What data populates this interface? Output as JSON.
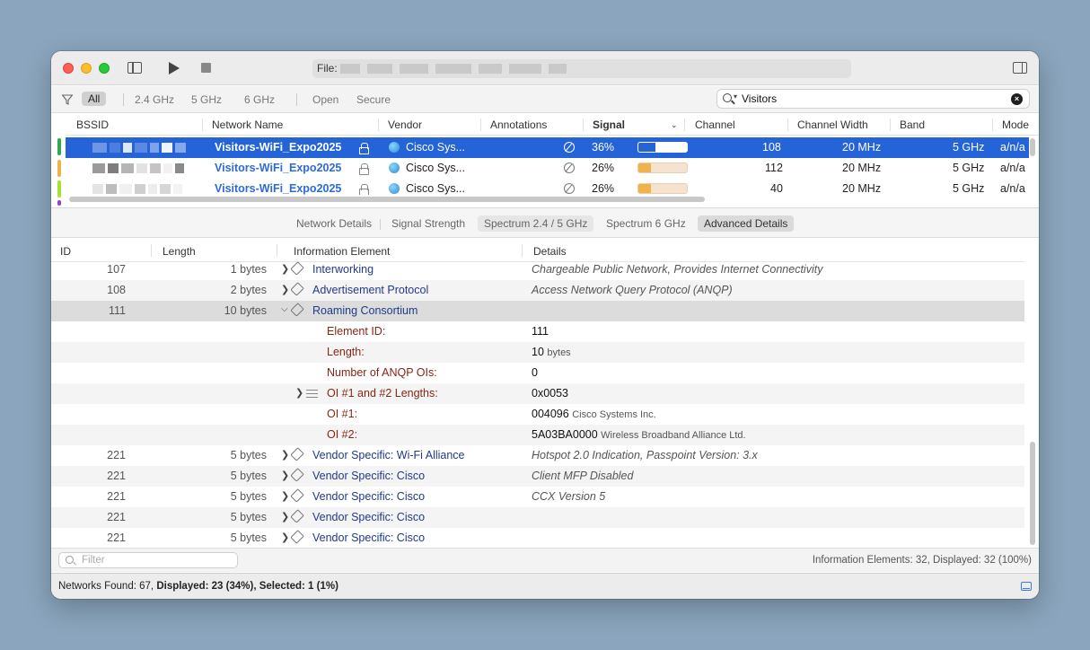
{
  "toolbar": {
    "file_label": "File:"
  },
  "filters": {
    "all": "All",
    "bands": [
      "2.4 GHz",
      "5 GHz",
      "6 GHz"
    ],
    "security": [
      "Open",
      "Secure"
    ],
    "search_value": "Visitors"
  },
  "networks": {
    "columns": [
      "BSSID",
      "Network Name",
      "Vendor",
      "Annotations",
      "Signal",
      "Channel",
      "Channel Width",
      "Band",
      "Mode"
    ],
    "rows": [
      {
        "name": "Visitors-WiFi_Expo2025",
        "vendor": "Cisco Sys...",
        "signal": "36%",
        "signal_level": 0.36,
        "channel": "108",
        "width": "20 MHz",
        "band": "5 GHz",
        "mode": "a/n/a",
        "tag_color": "#2fa84f",
        "selected": true
      },
      {
        "name": "Visitors-WiFi_Expo2025",
        "vendor": "Cisco Sys...",
        "signal": "26%",
        "signal_level": 0.26,
        "channel": "112",
        "width": "20 MHz",
        "band": "5 GHz",
        "mode": "a/n/a",
        "tag_color": "#f0b24a",
        "selected": false
      },
      {
        "name": "Visitors-WiFi_Expo2025",
        "vendor": "Cisco Sys...",
        "signal": "26%",
        "signal_level": 0.26,
        "channel": "40",
        "width": "20 MHz",
        "band": "5 GHz",
        "mode": "a/n/a",
        "tag_color": "#a6e22e",
        "selected": false
      }
    ]
  },
  "tabs": [
    "Network Details",
    "Signal Strength",
    "Spectrum 2.4 / 5 GHz",
    "Spectrum 6 GHz",
    "Advanced Details"
  ],
  "details": {
    "columns": [
      "ID",
      "Length",
      "Information Element",
      "Details"
    ],
    "rows": [
      {
        "id": "107",
        "length": "1 bytes",
        "name": "Interworking",
        "details": "Chargeable Public Network, Provides Internet Connectivity"
      },
      {
        "id": "108",
        "length": "2 bytes",
        "name": "Advertisement Protocol",
        "details": "Access Network Query Protocol (ANQP)"
      },
      {
        "id": "111",
        "length": "10 bytes",
        "name": "Roaming Consortium",
        "details": ""
      }
    ],
    "sub_rows": [
      {
        "label": "Element ID:",
        "value": "111",
        "note": ""
      },
      {
        "label": "Length:",
        "value": "10",
        "note": "bytes"
      },
      {
        "label": "Number of ANQP OIs:",
        "value": "0",
        "note": ""
      },
      {
        "label": "OI #1 and #2 Lengths:",
        "value": "0x0053",
        "note": ""
      },
      {
        "label": "OI #1:",
        "value": "004096",
        "note": "Cisco Systems Inc."
      },
      {
        "label": "OI #2:",
        "value": "5A03BA0000",
        "note": "Wireless Broadband Alliance Ltd."
      }
    ],
    "vendor_rows": [
      {
        "id": "221",
        "length": "5 bytes",
        "name": "Vendor Specific: Wi-Fi Alliance",
        "details": "Hotspot 2.0 Indication, Passpoint Version: 3.x"
      },
      {
        "id": "221",
        "length": "5 bytes",
        "name": "Vendor Specific: Cisco",
        "details": "Client MFP Disabled"
      },
      {
        "id": "221",
        "length": "5 bytes",
        "name": "Vendor Specific: Cisco",
        "details": "CCX Version 5"
      },
      {
        "id": "221",
        "length": "5 bytes",
        "name": "Vendor Specific: Cisco",
        "details": ""
      },
      {
        "id": "221",
        "length": "5 bytes",
        "name": "Vendor Specific: Cisco",
        "details": ""
      }
    ],
    "filter_placeholder": "Filter",
    "count": "Information Elements: 32, Displayed: 32 (100%)"
  },
  "status": {
    "found_label": "Networks Found: 67, ",
    "displayed": "Displayed: 23 (34%), ",
    "selected": "Selected: 1 (1%)"
  },
  "colors": {
    "accent": "#2463d8",
    "signal_selected": "#2463d8",
    "signal_other": "#f0b24a"
  }
}
